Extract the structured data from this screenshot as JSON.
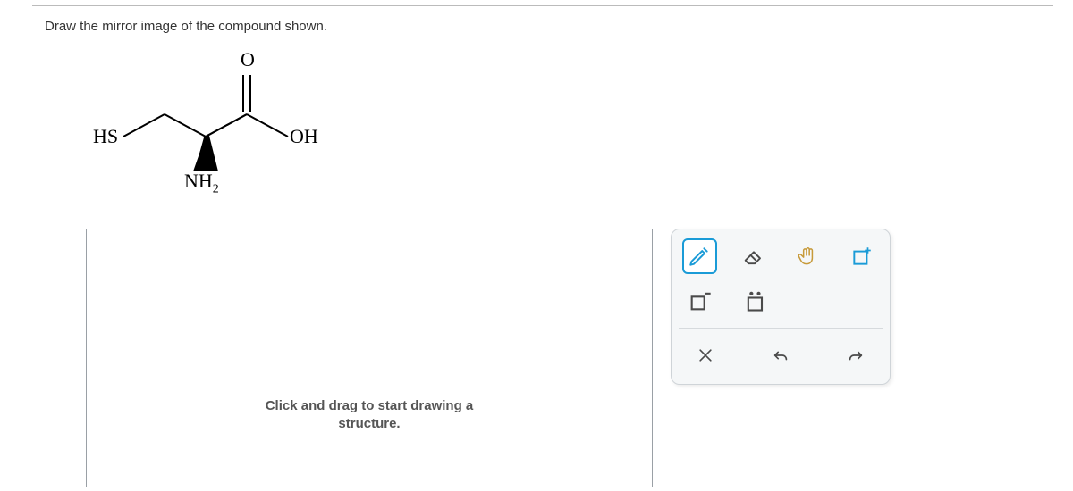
{
  "question": {
    "prompt": "Draw the mirror image of the compound shown."
  },
  "molecule": {
    "labels": {
      "hs": "HS",
      "o": "O",
      "oh": "OH",
      "nh2": "NH",
      "nh2_sub": "2"
    }
  },
  "canvas": {
    "hint_line1": "Click and drag to start drawing a",
    "hint_line2": "structure."
  },
  "tools": {
    "pencil": "pencil-icon",
    "eraser": "eraser-icon",
    "hand": "hand-icon",
    "add_box": "add-box-icon",
    "neg_box": "negative-charge-icon",
    "lone_pair": "lone-pair-icon",
    "close": "close-icon",
    "undo": "undo-icon",
    "redo": "redo-icon"
  }
}
